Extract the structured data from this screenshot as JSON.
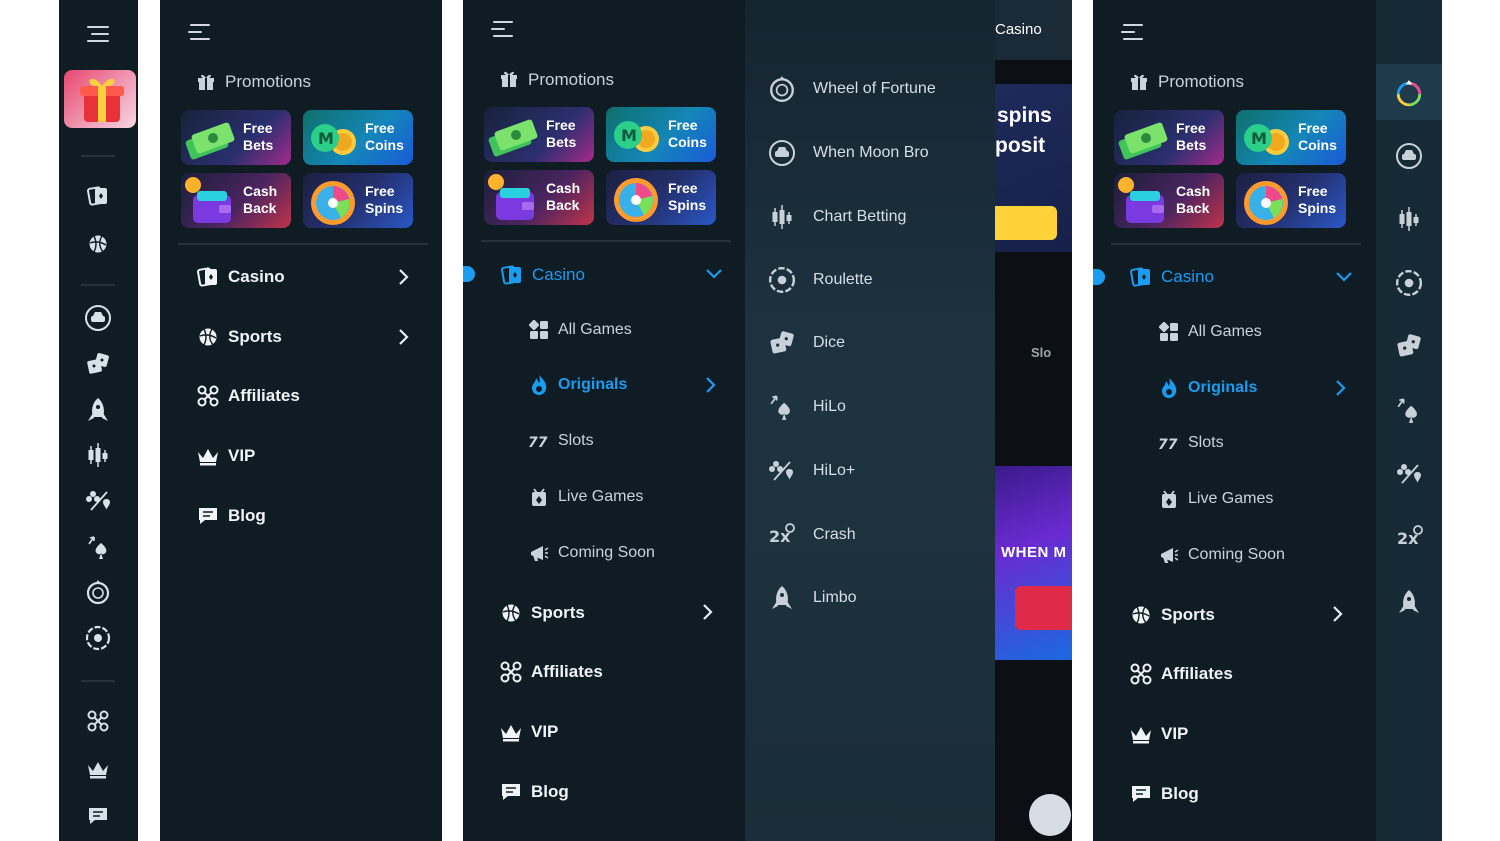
{
  "promotions": {
    "title": "Promotions",
    "cards": [
      {
        "label": "Free Bets",
        "icon": "cash-stack-icon"
      },
      {
        "label": "Free Coins",
        "icon": "coins-icon"
      },
      {
        "label": "Cash Back",
        "icon": "wallet-icon"
      },
      {
        "label": "Free Spins",
        "icon": "spin-wheel-icon"
      }
    ]
  },
  "nav_collapsed": [
    {
      "label": "Casino",
      "icon": "cards-icon"
    },
    {
      "label": "Sports",
      "icon": "basketball-icon"
    },
    {
      "label": "Affiliates",
      "icon": "network-icon"
    },
    {
      "label": "VIP",
      "icon": "crown-icon"
    },
    {
      "label": "Blog",
      "icon": "chat-icon"
    }
  ],
  "nav_expanded": {
    "casino": "Casino",
    "sub": [
      {
        "label": "All Games",
        "icon": "grid-icon"
      },
      {
        "label": "Originals",
        "icon": "flame-icon"
      },
      {
        "label": "Slots",
        "icon": "slots-777-icon"
      },
      {
        "label": "Live Games",
        "icon": "live-cards-icon"
      },
      {
        "label": "Coming Soon",
        "icon": "megaphone-icon"
      }
    ],
    "sports": "Sports",
    "affiliates": "Affiliates",
    "vip": "VIP",
    "blog": "Blog"
  },
  "originals": [
    {
      "label": "Wheel of Fortune",
      "icon": "wheel-icon"
    },
    {
      "label": "When Moon Bro",
      "icon": "moon-car-icon"
    },
    {
      "label": "Chart Betting",
      "icon": "candle-chart-icon"
    },
    {
      "label": "Roulette",
      "icon": "roulette-icon"
    },
    {
      "label": "Dice",
      "icon": "dice-icon"
    },
    {
      "label": "HiLo",
      "icon": "spade-arrow-icon"
    },
    {
      "label": "HiLo+",
      "icon": "suits-icon"
    },
    {
      "label": "Crash",
      "icon": "crash-2x-icon"
    },
    {
      "label": "Limbo",
      "icon": "rocket-icon"
    }
  ],
  "background": {
    "tab": "Casino",
    "banner_line1": "spins",
    "banner_line2": "posit",
    "slots_label": "Slo",
    "game_title": "WHEN M"
  },
  "colors": {
    "panel": "#0f1c24",
    "accent": "#1a9cf0",
    "text": "#f1f4f7"
  }
}
